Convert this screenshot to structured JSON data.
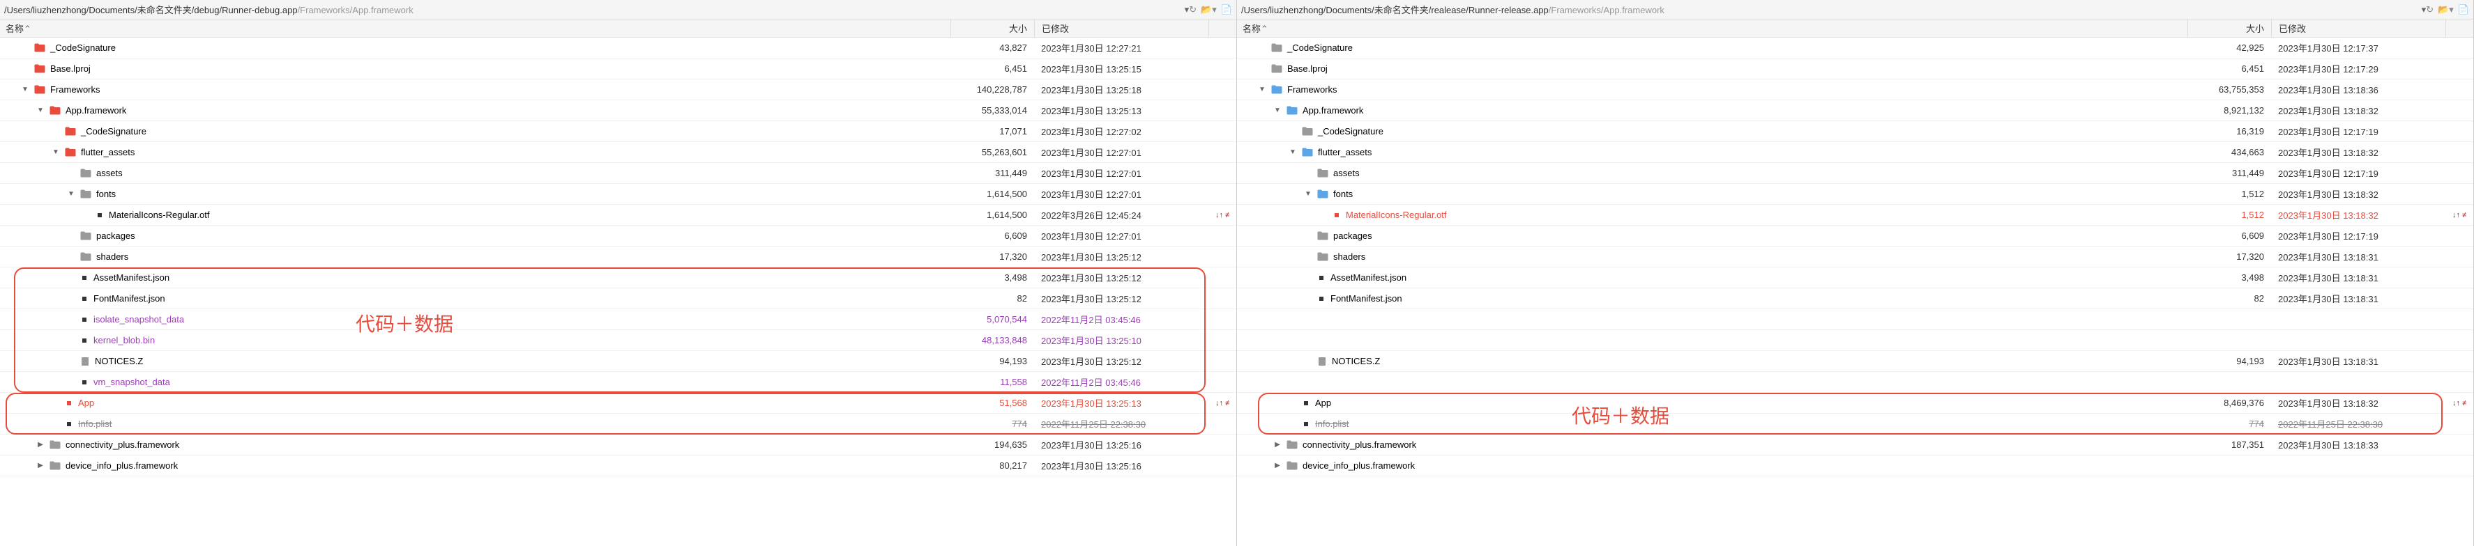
{
  "left": {
    "path_prefix": "/Users/liuzhenzhong/Documents/未命名文件夹/debug/Runner-debug.app",
    "path_suffix": "/Frameworks/App.framework",
    "cols": {
      "name": "名称",
      "size": "大小",
      "modified": "已修改"
    },
    "annotation": "代码＋数据",
    "diff_marker": "↓↑ ≠",
    "rows": [
      {
        "indent": 1,
        "type": "folder-red",
        "disc": "",
        "name": "_CodeSignature",
        "size": "43,827",
        "date": "2023年1月30日 12:27:21"
      },
      {
        "indent": 1,
        "type": "folder-red",
        "disc": "",
        "name": "Base.lproj",
        "size": "6,451",
        "date": "2023年1月30日 13:25:15"
      },
      {
        "indent": 1,
        "type": "folder-red",
        "disc": "▼",
        "name": "Frameworks",
        "size": "140,228,787",
        "date": "2023年1月30日 13:25:18"
      },
      {
        "indent": 2,
        "type": "folder-red",
        "disc": "▼",
        "name": "App.framework",
        "size": "55,333,014",
        "date": "2023年1月30日 13:25:13"
      },
      {
        "indent": 3,
        "type": "folder-red",
        "disc": "",
        "name": "_CodeSignature",
        "size": "17,071",
        "date": "2023年1月30日 12:27:02"
      },
      {
        "indent": 3,
        "type": "folder-red",
        "disc": "▼",
        "name": "flutter_assets",
        "size": "55,263,601",
        "date": "2023年1月30日 12:27:01"
      },
      {
        "indent": 4,
        "type": "folder-grey",
        "disc": "",
        "name": "assets",
        "size": "311,449",
        "date": "2023年1月30日 12:27:01"
      },
      {
        "indent": 4,
        "type": "folder-grey",
        "disc": "▼",
        "name": "fonts",
        "size": "1,614,500",
        "date": "2023年1月30日 12:27:01"
      },
      {
        "indent": 5,
        "type": "bullet",
        "name": "MaterialIcons-Regular.otf",
        "size": "1,614,500",
        "date": "2022年3月26日 12:45:24",
        "diff": true
      },
      {
        "indent": 4,
        "type": "folder-grey",
        "disc": "",
        "name": "packages",
        "size": "6,609",
        "date": "2023年1月30日 12:27:01"
      },
      {
        "indent": 4,
        "type": "folder-grey",
        "disc": "",
        "name": "shaders",
        "size": "17,320",
        "date": "2023年1月30日 13:25:12"
      }
    ],
    "hl1": [
      {
        "indent": 4,
        "type": "bullet",
        "name": "AssetManifest.json",
        "size": "3,498",
        "date": "2023年1月30日 13:25:12"
      },
      {
        "indent": 4,
        "type": "bullet",
        "name": "FontManifest.json",
        "size": "82",
        "date": "2023年1月30日 13:25:12"
      },
      {
        "indent": 4,
        "type": "bullet",
        "name": "isolate_snapshot_data",
        "cls": "text-purple",
        "size": "5,070,544",
        "date": "2022年11月2日 03:45:46"
      },
      {
        "indent": 4,
        "type": "bullet",
        "name": "kernel_blob.bin",
        "cls": "text-purple",
        "size": "48,133,848",
        "date": "2023年1月30日 13:25:10"
      },
      {
        "indent": 4,
        "type": "file-grey",
        "name": "NOTICES.Z",
        "size": "94,193",
        "date": "2023年1月30日 13:25:12"
      },
      {
        "indent": 4,
        "type": "bullet",
        "name": "vm_snapshot_data",
        "cls": "text-purple",
        "size": "11,558",
        "date": "2022年11月2日 03:45:46"
      }
    ],
    "hl2": [
      {
        "indent": 3,
        "type": "bullet-red",
        "name": "App",
        "cls": "text-red",
        "size": "51,568",
        "date": "2023年1月30日 13:25:13",
        "diff": true
      },
      {
        "indent": 3,
        "type": "bullet",
        "name": "Info.plist",
        "cls": "strike",
        "size": "774",
        "date": "2022年11月25日 22:38:30"
      }
    ],
    "rest": [
      {
        "indent": 2,
        "type": "folder-grey",
        "disc": "▶",
        "name": "connectivity_plus.framework",
        "size": "194,635",
        "date": "2023年1月30日 13:25:16"
      },
      {
        "indent": 2,
        "type": "folder-grey",
        "disc": "▶",
        "name": "device_info_plus.framework",
        "size": "80,217",
        "date": "2023年1月30日 13:25:16"
      }
    ]
  },
  "right": {
    "path_prefix": "/Users/liuzhenzhong/Documents/未命名文件夹/realease/Runner-release.app",
    "path_suffix": "/Frameworks/App.framework",
    "cols": {
      "name": "名称",
      "size": "大小",
      "modified": "已修改"
    },
    "annotation": "代码＋数据",
    "diff_marker": "↓↑ ≠",
    "rows": [
      {
        "indent": 1,
        "type": "folder-grey",
        "disc": "",
        "name": "_CodeSignature",
        "size": "42,925",
        "date": "2023年1月30日 12:17:37"
      },
      {
        "indent": 1,
        "type": "folder-grey",
        "disc": "",
        "name": "Base.lproj",
        "size": "6,451",
        "date": "2023年1月30日 12:17:29"
      },
      {
        "indent": 1,
        "type": "folder-blue",
        "disc": "▼",
        "name": "Frameworks",
        "size": "63,755,353",
        "date": "2023年1月30日 13:18:36"
      },
      {
        "indent": 2,
        "type": "folder-blue",
        "disc": "▼",
        "name": "App.framework",
        "size": "8,921,132",
        "date": "2023年1月30日 13:18:32"
      },
      {
        "indent": 3,
        "type": "folder-grey",
        "disc": "",
        "name": "_CodeSignature",
        "size": "16,319",
        "date": "2023年1月30日 12:17:19"
      },
      {
        "indent": 3,
        "type": "folder-blue",
        "disc": "▼",
        "name": "flutter_assets",
        "size": "434,663",
        "date": "2023年1月30日 13:18:32"
      },
      {
        "indent": 4,
        "type": "folder-grey",
        "disc": "",
        "name": "assets",
        "size": "311,449",
        "date": "2023年1月30日 12:17:19"
      },
      {
        "indent": 4,
        "type": "folder-blue",
        "disc": "▼",
        "name": "fonts",
        "size": "1,512",
        "date": "2023年1月30日 13:18:32"
      },
      {
        "indent": 5,
        "type": "bullet-red",
        "name": "MaterialIcons-Regular.otf",
        "cls": "text-red",
        "size": "1,512",
        "date": "2023年1月30日 13:18:32",
        "diff": true
      },
      {
        "indent": 4,
        "type": "folder-grey",
        "disc": "",
        "name": "packages",
        "size": "6,609",
        "date": "2023年1月30日 12:17:19"
      },
      {
        "indent": 4,
        "type": "folder-grey",
        "disc": "",
        "name": "shaders",
        "size": "17,320",
        "date": "2023年1月30日 13:18:31"
      },
      {
        "indent": 4,
        "type": "bullet",
        "name": "AssetManifest.json",
        "size": "3,498",
        "date": "2023年1月30日 13:18:31"
      },
      {
        "indent": 4,
        "type": "bullet",
        "name": "FontManifest.json",
        "size": "82",
        "date": "2023年1月30日 13:18:31"
      },
      {
        "indent": 4,
        "type": "spacer"
      },
      {
        "indent": 4,
        "type": "spacer"
      },
      {
        "indent": 4,
        "type": "file-grey",
        "name": "NOTICES.Z",
        "size": "94,193",
        "date": "2023年1月30日 13:18:31"
      },
      {
        "indent": 4,
        "type": "spacer"
      }
    ],
    "hl": [
      {
        "indent": 3,
        "type": "bullet",
        "name": "App",
        "size": "8,469,376",
        "date": "2023年1月30日 13:18:32",
        "diff": true
      },
      {
        "indent": 3,
        "type": "bullet",
        "name": "Info.plist",
        "cls": "strike",
        "size": "774",
        "date": "2022年11月25日 22:38:30"
      }
    ],
    "rest": [
      {
        "indent": 2,
        "type": "folder-grey",
        "disc": "▶",
        "name": "connectivity_plus.framework",
        "size": "187,351",
        "date": "2023年1月30日 13:18:33"
      },
      {
        "indent": 2,
        "type": "folder-grey",
        "disc": "▶",
        "name": "device_info_plus.framework",
        "size": "",
        "date": ""
      }
    ]
  }
}
